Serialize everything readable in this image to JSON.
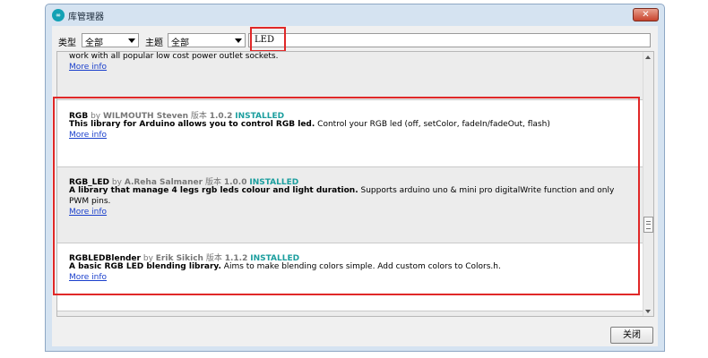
{
  "window": {
    "title": "库管理器",
    "logo_text": "∞",
    "close_glyph": "✕"
  },
  "filters": {
    "type_label": "类型",
    "type_value": "全部",
    "topic_label": "主题",
    "topic_value": "全部",
    "search_value": "LED"
  },
  "list": {
    "partial_top_text": "work with all popular low cost power outlet sockets.",
    "partial_top_more": "More info",
    "items": [
      {
        "name": "RGB",
        "by": "by",
        "author": "WILMOUTH Steven",
        "version_label": "版本",
        "version": "1.0.2",
        "status": "INSTALLED",
        "desc_bold": "This library for Arduino allows you to control RGB led.",
        "desc": "Control your RGB led (off, setColor, fadeIn/fadeOut, flash)",
        "desc2": "",
        "more": "More info"
      },
      {
        "name": "RGB_LED",
        "by": "by",
        "author": "A.Reha Salmaner",
        "version_label": "版本",
        "version": "1.0.0",
        "status": "INSTALLED",
        "desc_bold": "A library that manage 4 legs rgb leds colour and light duration.",
        "desc": "Supports arduino uno & mini pro digitalWrite function and only",
        "desc2": "PWM pins.",
        "more": "More info"
      },
      {
        "name": "RGBLEDBlender",
        "by": "by",
        "author": "Erik Sikich",
        "version_label": "版本",
        "version": "1.1.2",
        "status": "INSTALLED",
        "desc_bold": "A basic RGB LED blending library.",
        "desc": "Aims to make blending colors simple. Add custom colors to Colors.h.",
        "desc2": "",
        "more": "More info"
      }
    ]
  },
  "footer": {
    "close_label": "关闭"
  },
  "colors": {
    "highlight": "#e02828",
    "installed": "#1b9e9e",
    "link": "#1a3fcc",
    "titlebar": "#d5e3f1"
  }
}
